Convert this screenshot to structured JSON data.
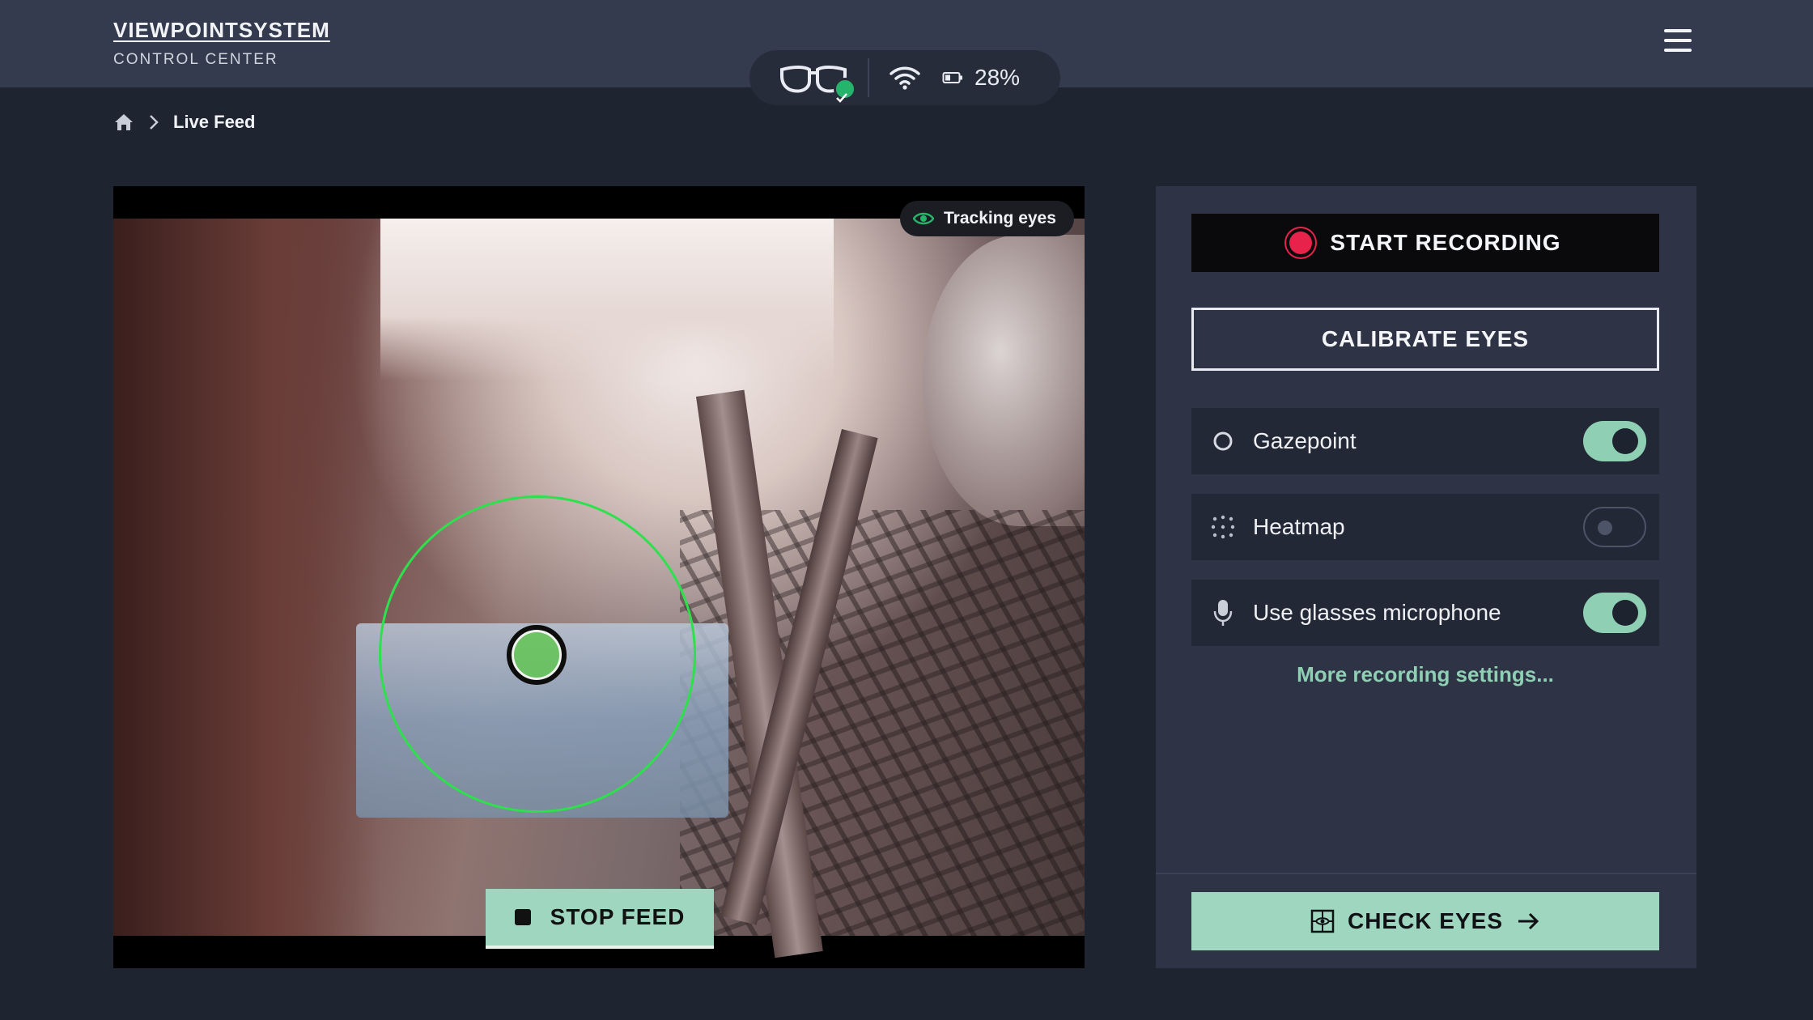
{
  "brand": {
    "name": "VIEWPOINTSYSTEM",
    "subtitle": "CONTROL CENTER"
  },
  "status": {
    "glasses_icon": "glasses-icon",
    "glasses_connected": true,
    "wifi_icon": "wifi-icon",
    "battery_icon": "battery-icon",
    "battery_text": "28%",
    "battery_level": 0.28
  },
  "menu_icon": "hamburger-menu-icon",
  "breadcrumb": {
    "home_icon": "home-icon",
    "separator_icon": "chevron-right-icon",
    "current": "Live Feed"
  },
  "video": {
    "tracking_badge": "Tracking eyes",
    "tracking_icon": "eye-icon",
    "stop_feed_label": "STOP FEED",
    "stop_icon": "stop-icon"
  },
  "panel": {
    "start_recording_label": "START RECORDING",
    "calibrate_label": "CALIBRATE EYES",
    "toggles": [
      {
        "label": "Gazepoint",
        "icon": "gazepoint-icon",
        "on": true
      },
      {
        "label": "Heatmap",
        "icon": "heatmap-icon",
        "on": false
      },
      {
        "label": "Use glasses microphone",
        "icon": "microphone-icon",
        "on": true
      }
    ],
    "more_settings_label": "More recording settings...",
    "check_eyes_label": "CHECK EYES"
  },
  "colors": {
    "accent": "#9fd6bf",
    "record_red": "#e8234b",
    "gaze_green": "#2fe04d",
    "topbar_bg": "#353b4e",
    "page_bg": "#1f2431",
    "panel_bg": "#2e3445"
  }
}
